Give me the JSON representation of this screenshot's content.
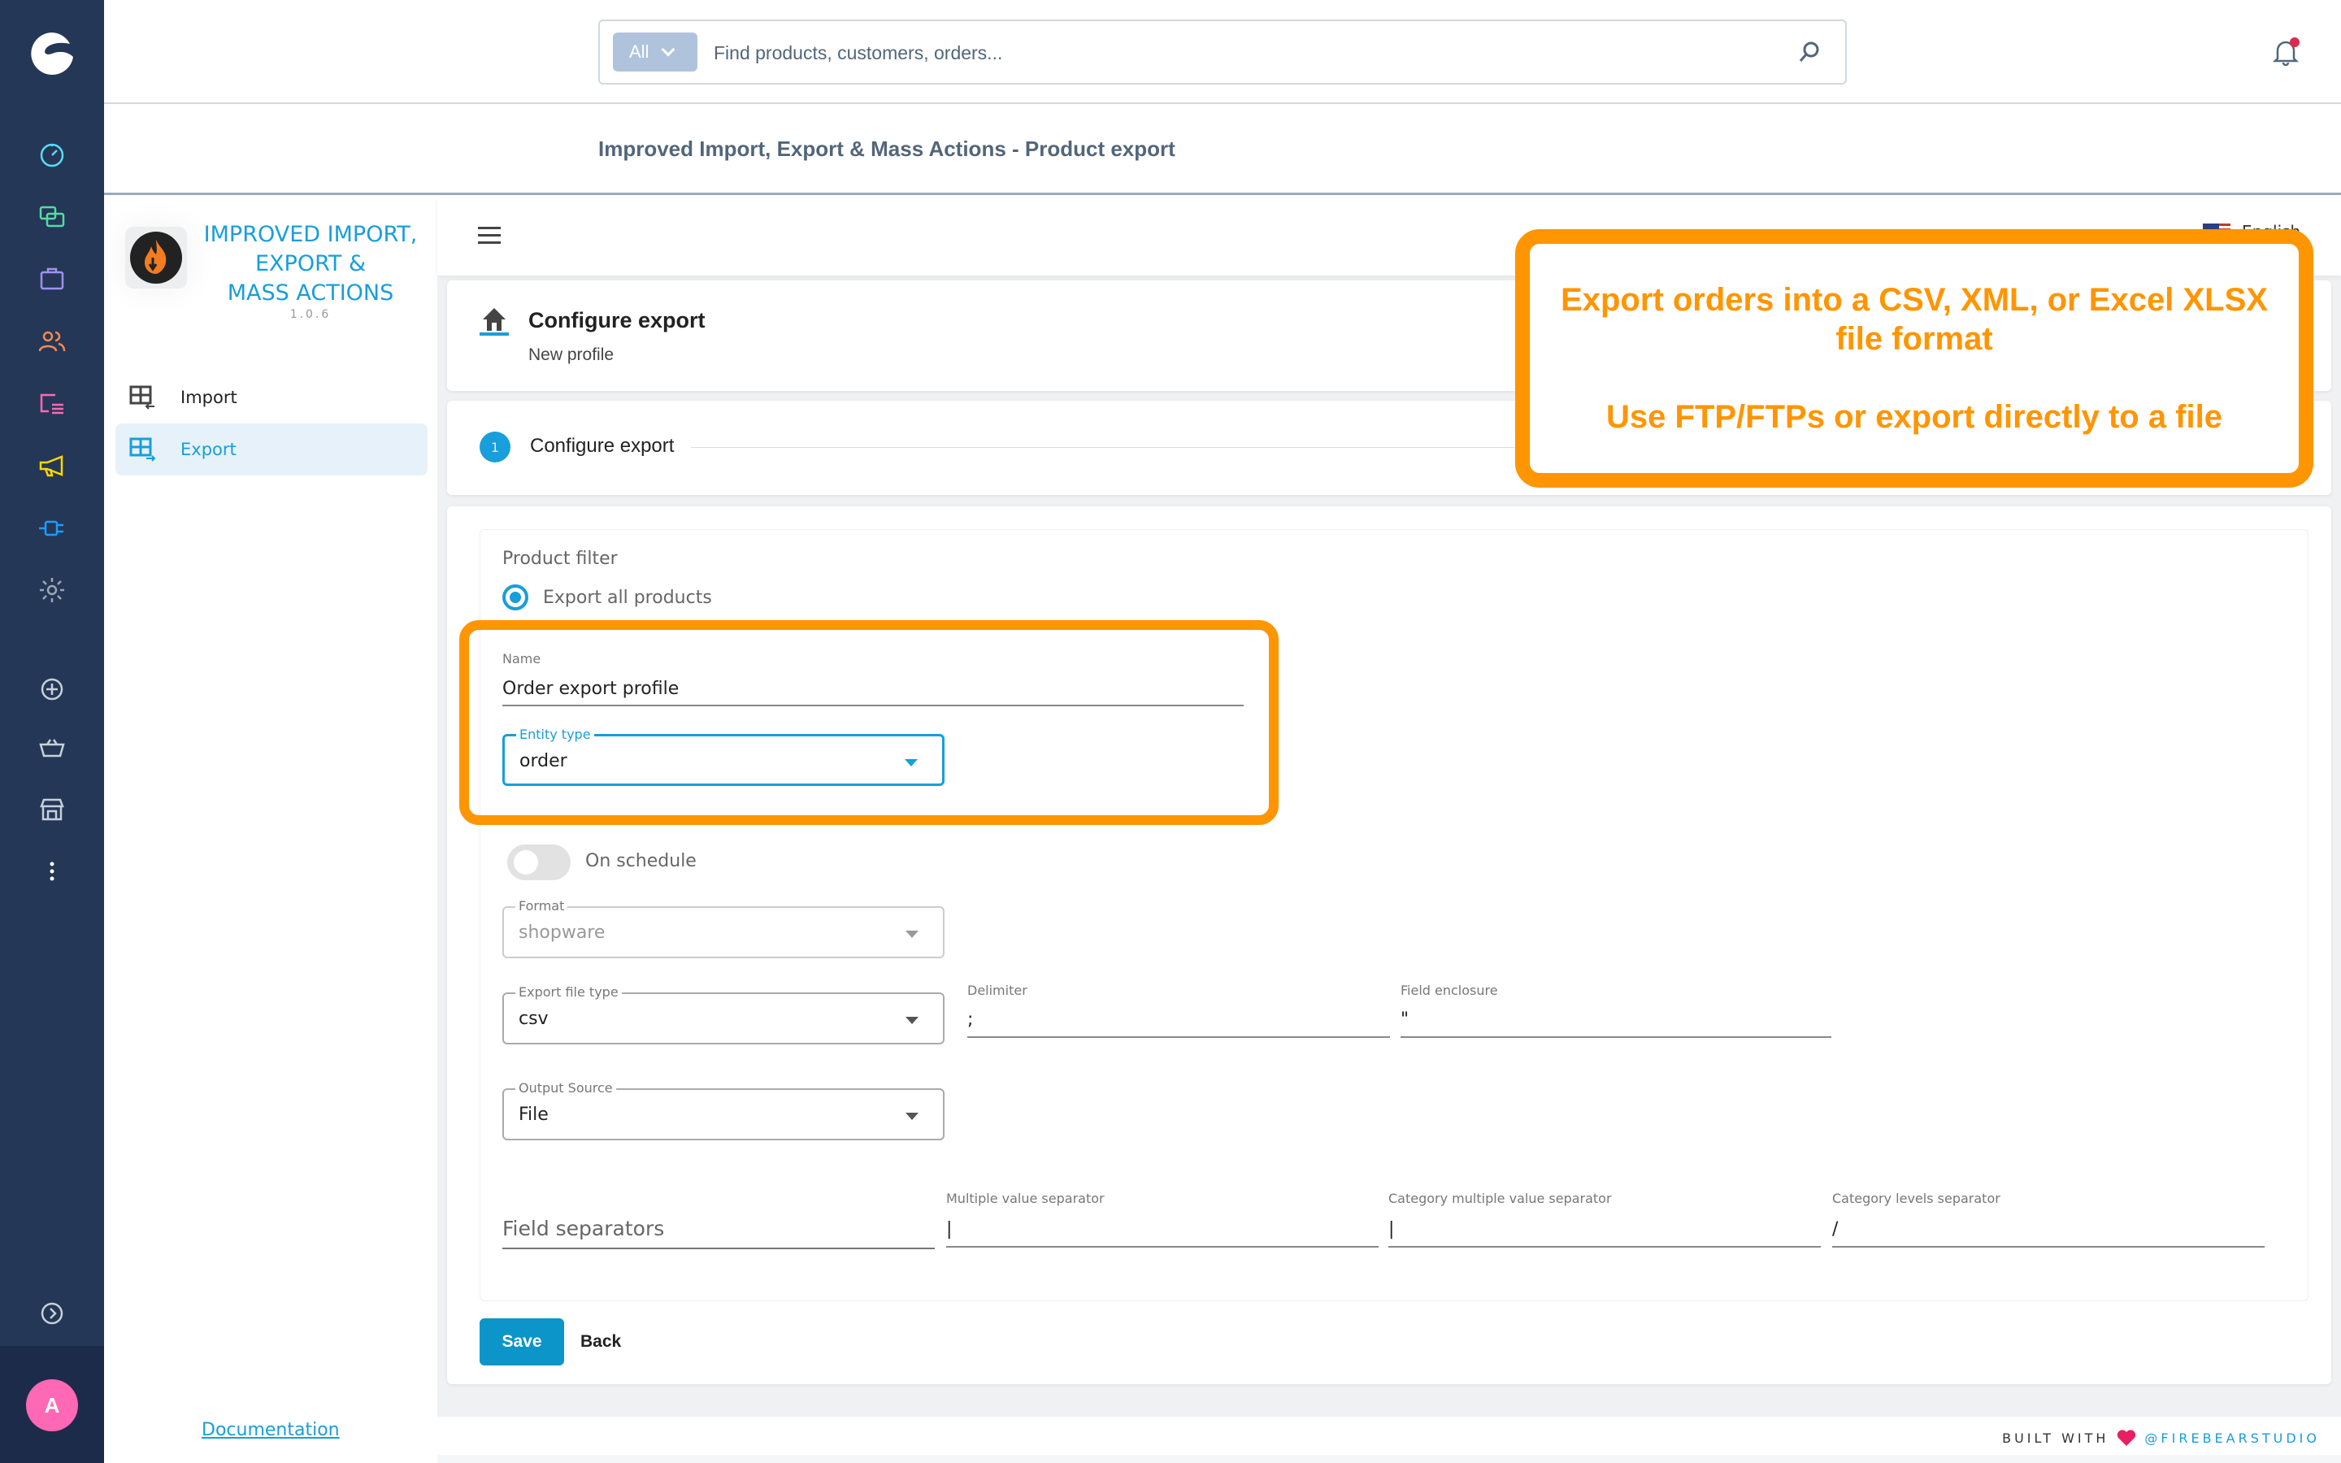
{
  "admin_nav": {
    "items": [
      {
        "name": "dashboard",
        "color": "#57d9f5"
      },
      {
        "name": "catalogues",
        "color": "#57d9a3"
      },
      {
        "name": "orders",
        "color": "#a092f0"
      },
      {
        "name": "customers",
        "color": "#f98850"
      },
      {
        "name": "content",
        "color": "#ff68b4"
      },
      {
        "name": "marketing",
        "color": "#ffd700"
      },
      {
        "name": "extensions",
        "color": "#189eff"
      },
      {
        "name": "settings",
        "color": "#9aa8b5"
      }
    ],
    "avatar_initial": "A"
  },
  "topbar": {
    "search_scope": "All",
    "search_placeholder": "Find products, customers, orders...",
    "notification_dot_color": "#de294c"
  },
  "page_title": "Improved Import, Export & Mass Actions - Product export",
  "plugin_sidebar": {
    "name_lines": [
      "IMPROVED IMPORT,",
      "EXPORT &",
      "MASS ACTIONS"
    ],
    "version": "1.0.6",
    "items": [
      {
        "label": "Import",
        "active": false
      },
      {
        "label": "Export",
        "active": true
      }
    ],
    "documentation_link": "Documentation"
  },
  "main": {
    "language": "English",
    "header": {
      "title": "Configure export",
      "subtitle": "New profile"
    },
    "stepper": {
      "steps": [
        {
          "number": "1",
          "label": "Configure export"
        }
      ]
    },
    "form": {
      "product_filter_label": "Product filter",
      "export_all_label": "Export all products",
      "export_all_selected": true,
      "name": {
        "label": "Name",
        "value": "Order export profile"
      },
      "entity_type": {
        "label": "Entity type",
        "value": "order"
      },
      "on_schedule": {
        "label": "On schedule",
        "enabled": false
      },
      "format": {
        "label": "Format",
        "value": "shopware",
        "disabled": true
      },
      "export_file_type": {
        "label": "Export file type",
        "value": "csv"
      },
      "delimiter": {
        "label": "Delimiter",
        "value": ";"
      },
      "field_enclosure": {
        "label": "Field enclosure",
        "value": "\""
      },
      "output_source": {
        "label": "Output Source",
        "value": "File"
      },
      "field_separators_label": "Field separators",
      "multiple_value_separator": {
        "label": "Multiple value separator",
        "value": "|"
      },
      "category_multiple_value_separator": {
        "label": "Category multiple value separator",
        "value": "|"
      },
      "category_levels_separator": {
        "label": "Category levels separator",
        "value": "/"
      }
    },
    "save_label": "Save",
    "back_label": "Back"
  },
  "footer": {
    "built_with": "BUILT WITH",
    "studio": "@FIREBEARSTUDIO"
  },
  "annotation": {
    "line1": "Export orders into a CSV, XML, or Excel XLSX file format",
    "line2": "Use FTP/FTPs or export directly to a file",
    "color": "#ff9500"
  }
}
